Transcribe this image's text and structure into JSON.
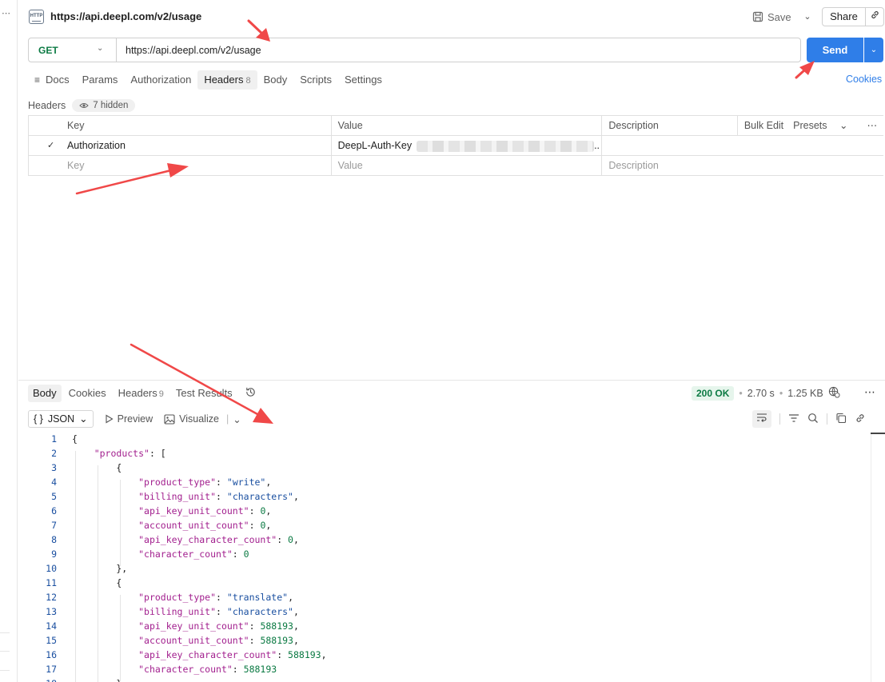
{
  "request": {
    "title": "https://api.deepl.com/v2/usage",
    "http_badge": "HTTP",
    "save_label": "Save",
    "share_label": "Share",
    "method": "GET",
    "url": "https://api.deepl.com/v2/usage",
    "send_label": "Send",
    "tabs": [
      {
        "label": "Docs"
      },
      {
        "label": "Params"
      },
      {
        "label": "Authorization"
      },
      {
        "label": "Headers",
        "count": "8",
        "active": true
      },
      {
        "label": "Body"
      },
      {
        "label": "Scripts"
      },
      {
        "label": "Settings"
      }
    ],
    "cookies_label": "Cookies"
  },
  "headers": {
    "label": "Headers",
    "hidden_label": "7 hidden",
    "columns": {
      "key": "Key",
      "value": "Value",
      "description": "Description"
    },
    "bulk_edit_label": "Bulk Edit",
    "presets_label": "Presets",
    "row": {
      "key": "Authorization",
      "value": "DeepL-Auth-Key",
      "checked": true
    },
    "new_row": {
      "key_placeholder": "Key",
      "value_placeholder": "Value",
      "description_placeholder": "Description"
    }
  },
  "response": {
    "tabs": [
      {
        "label": "Body",
        "active": true
      },
      {
        "label": "Cookies"
      },
      {
        "label": "Headers",
        "count": "9"
      },
      {
        "label": "Test Results"
      }
    ],
    "status": "200 OK",
    "time": "2.70 s",
    "size": "1.25 KB",
    "format": "JSON",
    "preview_label": "Preview",
    "visualize_label": "Visualize",
    "code_lines": [
      "{",
      "    \"products\": [",
      "        {",
      "            \"product_type\": \"write\",",
      "            \"billing_unit\": \"characters\",",
      "            \"api_key_unit_count\": 0,",
      "            \"account_unit_count\": 0,",
      "            \"api_key_character_count\": 0,",
      "            \"character_count\": 0",
      "        },",
      "        {",
      "            \"product_type\": \"translate\",",
      "            \"billing_unit\": \"characters\",",
      "            \"api_key_unit_count\": 588193,",
      "            \"account_unit_count\": 588193,",
      "            \"api_key_character_count\": 588193,",
      "            \"character_count\": 588193",
      "        },"
    ]
  },
  "colors": {
    "accent": "#2f7ee8",
    "method_get": "#0b7a43",
    "annotation_arrow": "#f04848"
  }
}
